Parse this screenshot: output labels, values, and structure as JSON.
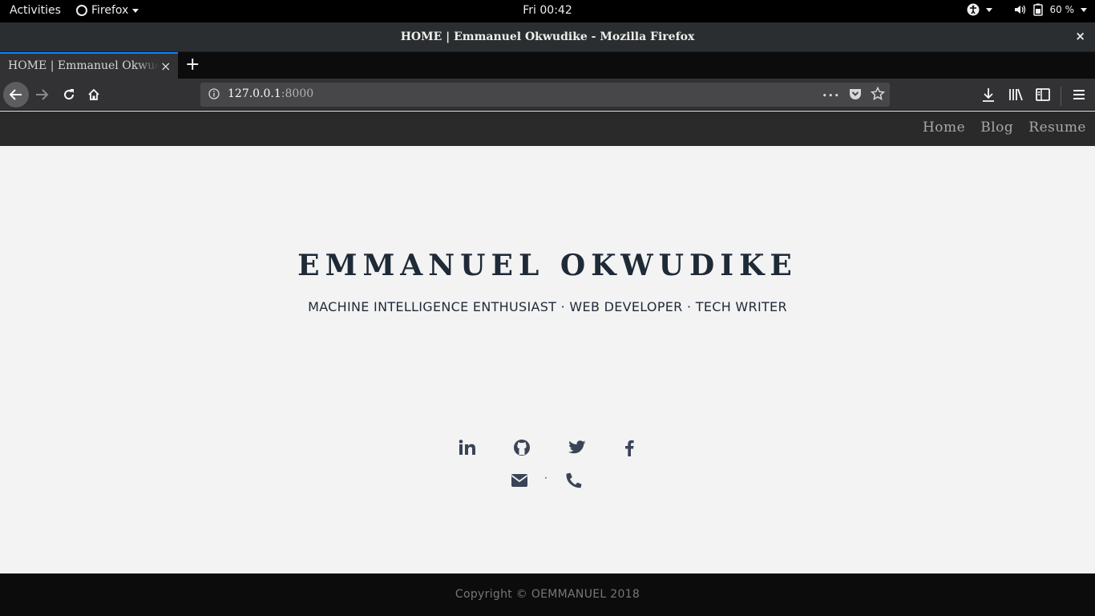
{
  "os_topbar": {
    "activities": "Activities",
    "app_name": "Firefox",
    "clock": "Fri 00:42",
    "battery": "60 %"
  },
  "window": {
    "title": "HOME | Emmanuel Okwudike - Mozilla Firefox",
    "close": "×"
  },
  "tabs": [
    {
      "title": "HOME | Emmanuel Okwudike",
      "close": "×"
    }
  ],
  "new_tab": "+",
  "urlbar": {
    "host": "127.0.0.1",
    "port": ":8000",
    "more": "•••"
  },
  "site": {
    "nav": [
      "Home",
      "Blog",
      "Resume"
    ],
    "name": "EMMANUEL OKWUDIKE",
    "tagline": "MACHINE INTELLIGENCE ENTHUSIAST · WEB DEVELOPER · TECH WRITER",
    "social_icons": [
      "linkedin-icon",
      "github-icon",
      "twitter-icon",
      "facebook-icon"
    ],
    "contact_icons": [
      "email-icon",
      "phone-icon"
    ],
    "contact_separator": "·",
    "footer": "Copyright © OEMMANUEL 2018",
    "colors": {
      "heading": "#1f2a37",
      "icon": "#3b4457",
      "nav_bg": "#2a2a2a",
      "footer_bg": "#0c0c0c",
      "page_bg": "#f3f3f3"
    }
  }
}
